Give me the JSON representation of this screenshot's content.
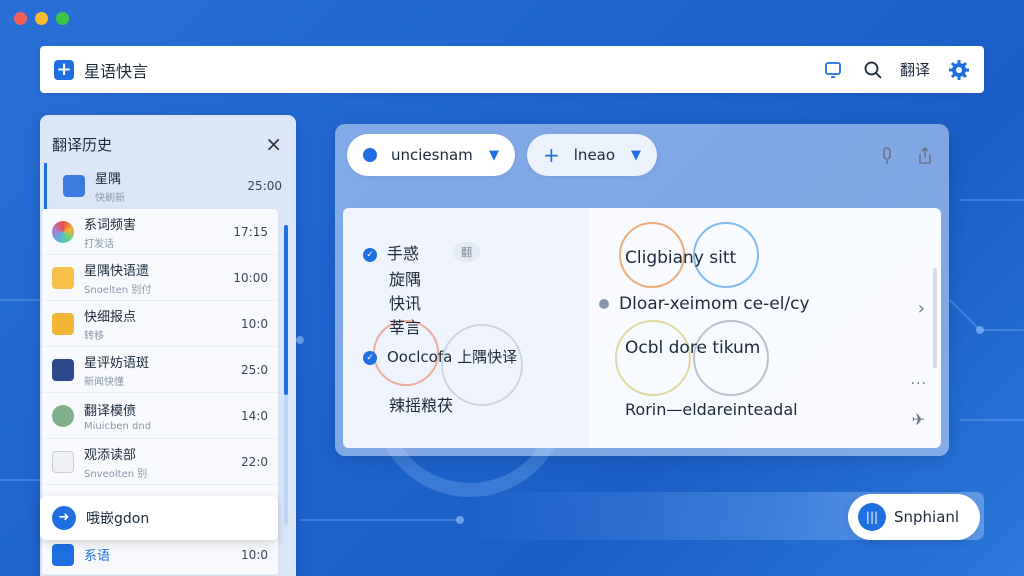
{
  "app": {
    "title": "星语快言"
  },
  "topbar": {
    "icons": [
      "device-icon",
      "search-icon",
      "settings-icon"
    ],
    "translate_label": "翻译"
  },
  "sidebar": {
    "title": "翻译历史",
    "close": "×",
    "active_item": {
      "name": "星隅",
      "sub": "快刷新",
      "time": "25:00"
    },
    "items": [
      {
        "name": "系词频害",
        "sub": "打发话",
        "time": "17:15",
        "icon": "color-wheel-icon"
      },
      {
        "name": "星隅快语遗",
        "sub": "Snoelten 别付",
        "time": "10:00",
        "icon": "folder-icon"
      },
      {
        "name": "快细报点",
        "sub": "转移",
        "time": "10:0",
        "icon": "folder-icon"
      },
      {
        "name": "星评妨语斑",
        "sub": "新闻快懂",
        "time": "25:0",
        "icon": "book-icon"
      },
      {
        "name": "翻译模偾",
        "sub": "Miuicben dnd",
        "time": "14:0",
        "icon": "help-icon"
      },
      {
        "name": "观添读部",
        "sub": "Snveolten 别",
        "time": "22:0",
        "icon": "document-icon"
      }
    ],
    "bottom_item": {
      "name": "系语",
      "time": "10:0"
    },
    "float_card": {
      "label": "哦嵌gdon"
    }
  },
  "main": {
    "source_lang": "unciesnam",
    "target_lang": "lneao",
    "source_lines": [
      "手惑",
      "旋隅",
      "快讯",
      "莘言"
    ],
    "source_tag": "翻",
    "source_extra": "Ooclcofa 上隅快译",
    "source_footer": "辣摇粮茯",
    "target_lines": [
      "Cligbiany sitt",
      "Dloar-xeimom ce-el/cy",
      "Ocbl dore tikum",
      "Rorin—eldareinteadal"
    ]
  },
  "voice": {
    "label": "Snphianl"
  },
  "colors": {
    "accent": "#1f6fe0",
    "background": "#1f64d0"
  }
}
